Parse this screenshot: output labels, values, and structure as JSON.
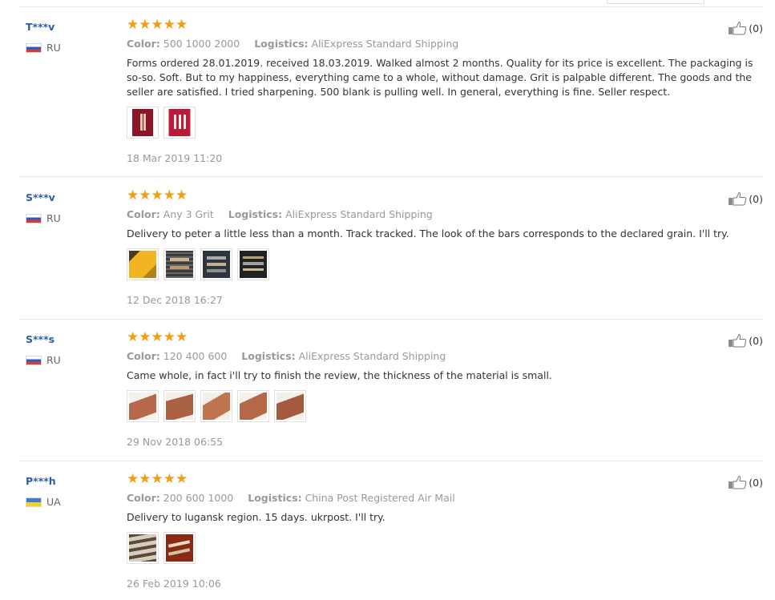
{
  "reviews": [
    {
      "user": "T***v",
      "country": "RU",
      "flag": "ru",
      "rating": 5,
      "color_label": "Color:",
      "color_value": "500 1000 2000",
      "logistics_label": "Logistics:",
      "logistics_value": "AliExpress Standard Shipping",
      "text": "Forms ordered 28.01.2019. received 18.03.2019. Walked almost 2 months. Quality for its price is excellent. The packaging is so-so. Soft. But to my happiness, everything came to a whole, without damage. Grit is palpable different. The goods and the seller are satisfied. I tried sharpening. 500 blank is pulling well. In general, everything is fine. Seller respect.",
      "photos": [
        "red-package",
        "red-package-open"
      ],
      "date": "18 Mar 2019 11:20",
      "likes": "(0)"
    },
    {
      "user": "S***v",
      "country": "RU",
      "flag": "ru",
      "rating": 5,
      "color_label": "Color:",
      "color_value": "Any 3 Grit",
      "logistics_label": "Logistics:",
      "logistics_value": "AliExpress Standard Shipping",
      "text": "Delivery to peter a little less than a month. Track tracked. The look of the bars corresponds to the declared grain. I'll try.",
      "photos": [
        "yellow-stones",
        "bars-on-grid",
        "bars-dark",
        "bars-row"
      ],
      "date": "12 Dec 2018 16:27",
      "likes": "(0)"
    },
    {
      "user": "S***s",
      "country": "RU",
      "flag": "ru",
      "rating": 5,
      "color_label": "Color:",
      "color_value": "120 400 600",
      "logistics_label": "Logistics:",
      "logistics_value": "AliExpress Standard Shipping",
      "text": "Came whole, in fact i'll try to finish the review, the thickness of the material is small.",
      "photos": [
        "hand-bar-1",
        "hand-bar-2",
        "hand-bar-3",
        "hand-bar-4",
        "hand-bar-5"
      ],
      "date": "29 Nov 2018 06:55",
      "likes": "(0)"
    },
    {
      "user": "P***h",
      "country": "UA",
      "flag": "ua",
      "rating": 5,
      "color_label": "Color:",
      "color_value": "200 600 1000",
      "logistics_label": "Logistics:",
      "logistics_value": "China Post Registered Air Mail",
      "text": "Delivery to lugansk region. 15 days. ukrpost. I'll try.",
      "photos": [
        "stacked-bars",
        "bars-on-red"
      ],
      "date": "26 Feb 2019 10:06",
      "likes": "(0)"
    }
  ],
  "colors": {
    "username": "#2a5db0",
    "star": "#f29d13",
    "muted": "#999999"
  }
}
